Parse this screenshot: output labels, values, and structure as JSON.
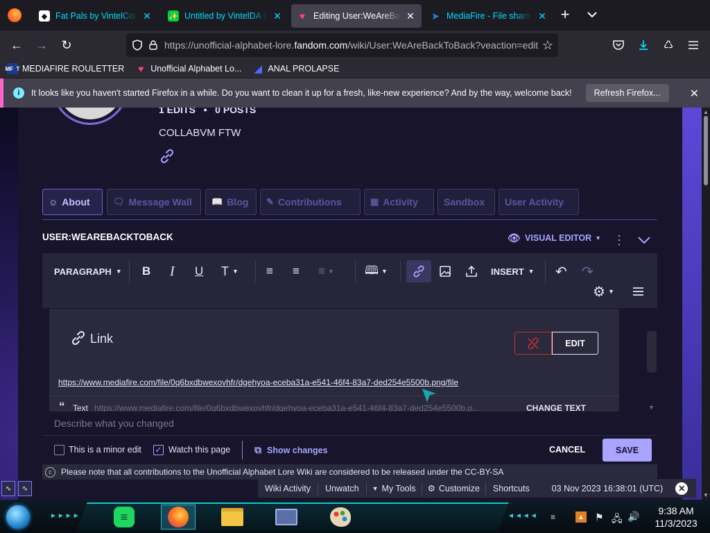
{
  "browser": {
    "tabs": [
      {
        "title": "Fat Pals by VintelCompa",
        "favicon_color": "#111111",
        "style": "cyan"
      },
      {
        "title": "Untitled by VintelDA on",
        "favicon_color": "#1a1a1a",
        "style": "cyan"
      },
      {
        "title": "Editing User:WeAreBack",
        "favicon_color": "#ff3d7f",
        "style": "active"
      },
      {
        "title": "MediaFire - File sharing",
        "favicon_color": "#1e88e5",
        "style": "cyan"
      }
    ],
    "new_tab": "+",
    "url_prefix": "https://unofficial-alphabet-lore.",
    "url_host": "fandom.com",
    "url_suffix": "/wiki/User:WeAreBackToBack?veaction=edit",
    "bookmarks": [
      {
        "label": "MEDIAFIRE ROULETTER",
        "icon": "MF  T"
      },
      {
        "label": "Unofficial Alphabet Lo...",
        "icon": ""
      },
      {
        "label": "ANAL PROLAPSE",
        "icon": ""
      }
    ],
    "notification": {
      "message": "It looks like you haven't started Firefox in a while. Do you want to clean it up for a fresh, like-new experience? And by the way, welcome back!",
      "button": "Refresh Firefox..."
    }
  },
  "profile": {
    "stats": "1 EDITS   •   0 POSTS",
    "bio": "COLLABVM FTW"
  },
  "user_tabs": [
    "About",
    "Message Wall",
    "Blog",
    "Contributions",
    "Activity",
    "Sandbox",
    "User Activity"
  ],
  "editor": {
    "page_title": "USER:WEAREBACKTOBACK",
    "mode": "VISUAL EDITOR",
    "paragraph": "PARAGRAPH",
    "insert": "INSERT"
  },
  "link_dialog": {
    "title": "Link",
    "edit_button": "EDIT",
    "url": "https://www.mediafire.com/file/0q6bxdbwexovhfr/dgehyoa-eceba31a-e541-46f4-83a7-ded254e5500b.png/file",
    "text_label": "Text",
    "text_value": "https://www.mediafire.com/file/0q6bxdbwexovhfr/dgehyoa-eceba31a-e541-46f4-83a7-ded254e5500b.p...",
    "change_text": "CHANGE TEXT"
  },
  "save_bar": {
    "summary_placeholder": "Describe what you changed",
    "minor_edit": "This is a minor edit",
    "watch_page": "Watch this page",
    "show_changes": "Show changes",
    "cancel": "CANCEL",
    "save": "SAVE",
    "license_note": "Please note that all contributions to the Unofficial Alphabet Lore Wiki are considered to be released under the CC-BY-SA"
  },
  "wiki_toolbar": {
    "items": [
      "Wiki Activity",
      "Unwatch",
      "My Tools",
      "Customize",
      "Shortcuts"
    ],
    "timestamp": "03 Nov 2023 16:38:01 (UTC)"
  },
  "taskbar": {
    "time": "9:38 AM",
    "date": "11/3/2023"
  },
  "colors": {
    "accent": "#a8a4ff",
    "save_bg": "#a8a4ff",
    "page_bg": "#17142b",
    "notif_accent": "#ff65c9"
  }
}
